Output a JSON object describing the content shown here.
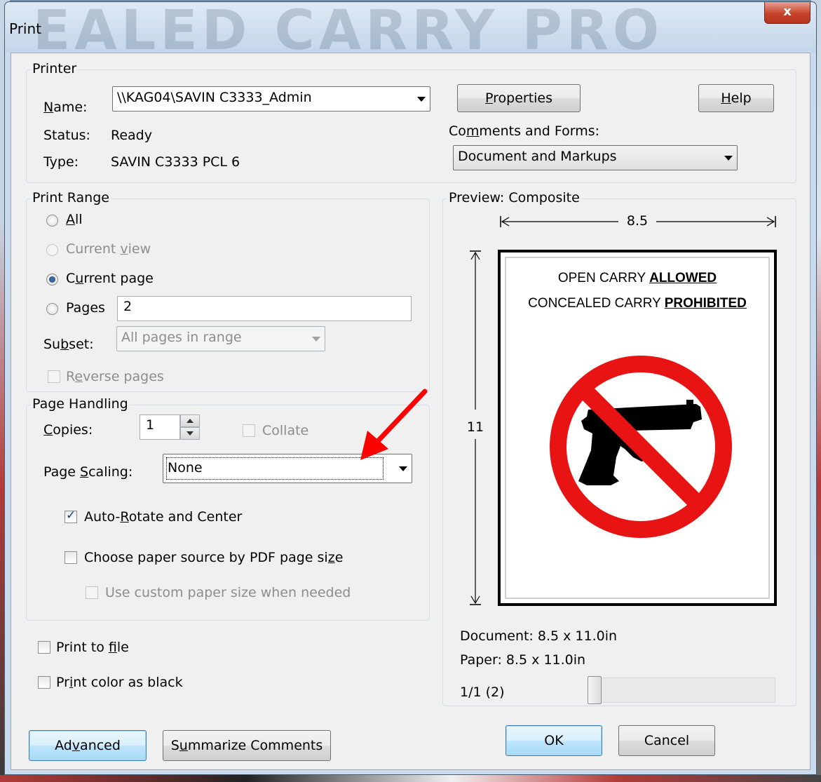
{
  "window": {
    "title": "Print",
    "watermark": "EALED CARRY PRO",
    "close_glyph": "x"
  },
  "printer": {
    "group_label": "Printer",
    "name_label": "Name:",
    "name_value": "\\\\KAG04\\SAVIN C3333_Admin",
    "status_label": "Status:",
    "status_value": "Ready",
    "type_label": "Type:",
    "type_value": "SAVIN C3333 PCL 6",
    "properties_button": "Properties",
    "help_button": "Help",
    "comments_label": "Comments and Forms:",
    "comments_value": "Document and Markups"
  },
  "print_range": {
    "group_label": "Print Range",
    "all": "All",
    "current_view": "Current view",
    "current_page": "Current page",
    "pages": "Pages",
    "pages_value": "2",
    "subset_label": "Subset:",
    "subset_value": "All pages in range",
    "reverse_pages": "Reverse pages",
    "selected": "current_page"
  },
  "page_handling": {
    "group_label": "Page Handling",
    "copies_label": "Copies:",
    "copies_value": "1",
    "collate": "Collate",
    "scaling_label": "Page Scaling:",
    "scaling_value": "None",
    "auto_rotate": "Auto-Rotate and Center",
    "auto_rotate_checked": true,
    "choose_paper": "Choose paper source by PDF page size",
    "choose_paper_checked": false,
    "custom_paper": "Use custom paper size when needed",
    "custom_paper_checked": false
  },
  "options": {
    "print_to_file": "Print to file",
    "print_color_black": "Print color as black"
  },
  "preview": {
    "group_label": "Preview: Composite",
    "width_dim": "8.5",
    "height_dim": "11",
    "sign_line1_prefix": "OPEN CARRY ",
    "sign_line1_emph": "ALLOWED",
    "sign_line2_prefix": "CONCEALED CARRY ",
    "sign_line2_emph": "PROHIBITED",
    "document_size": "Document: 8.5 x 11.0in",
    "paper_size": "Paper: 8.5 x 11.0in",
    "page_counter": "1/1 (2)",
    "slider_position": 0
  },
  "buttons": {
    "advanced": "Advanced",
    "summarize": "Summarize Comments",
    "ok": "OK",
    "cancel": "Cancel"
  },
  "colors": {
    "annotation_arrow": "#ff0000",
    "prohibit_sign": "#e81414"
  }
}
